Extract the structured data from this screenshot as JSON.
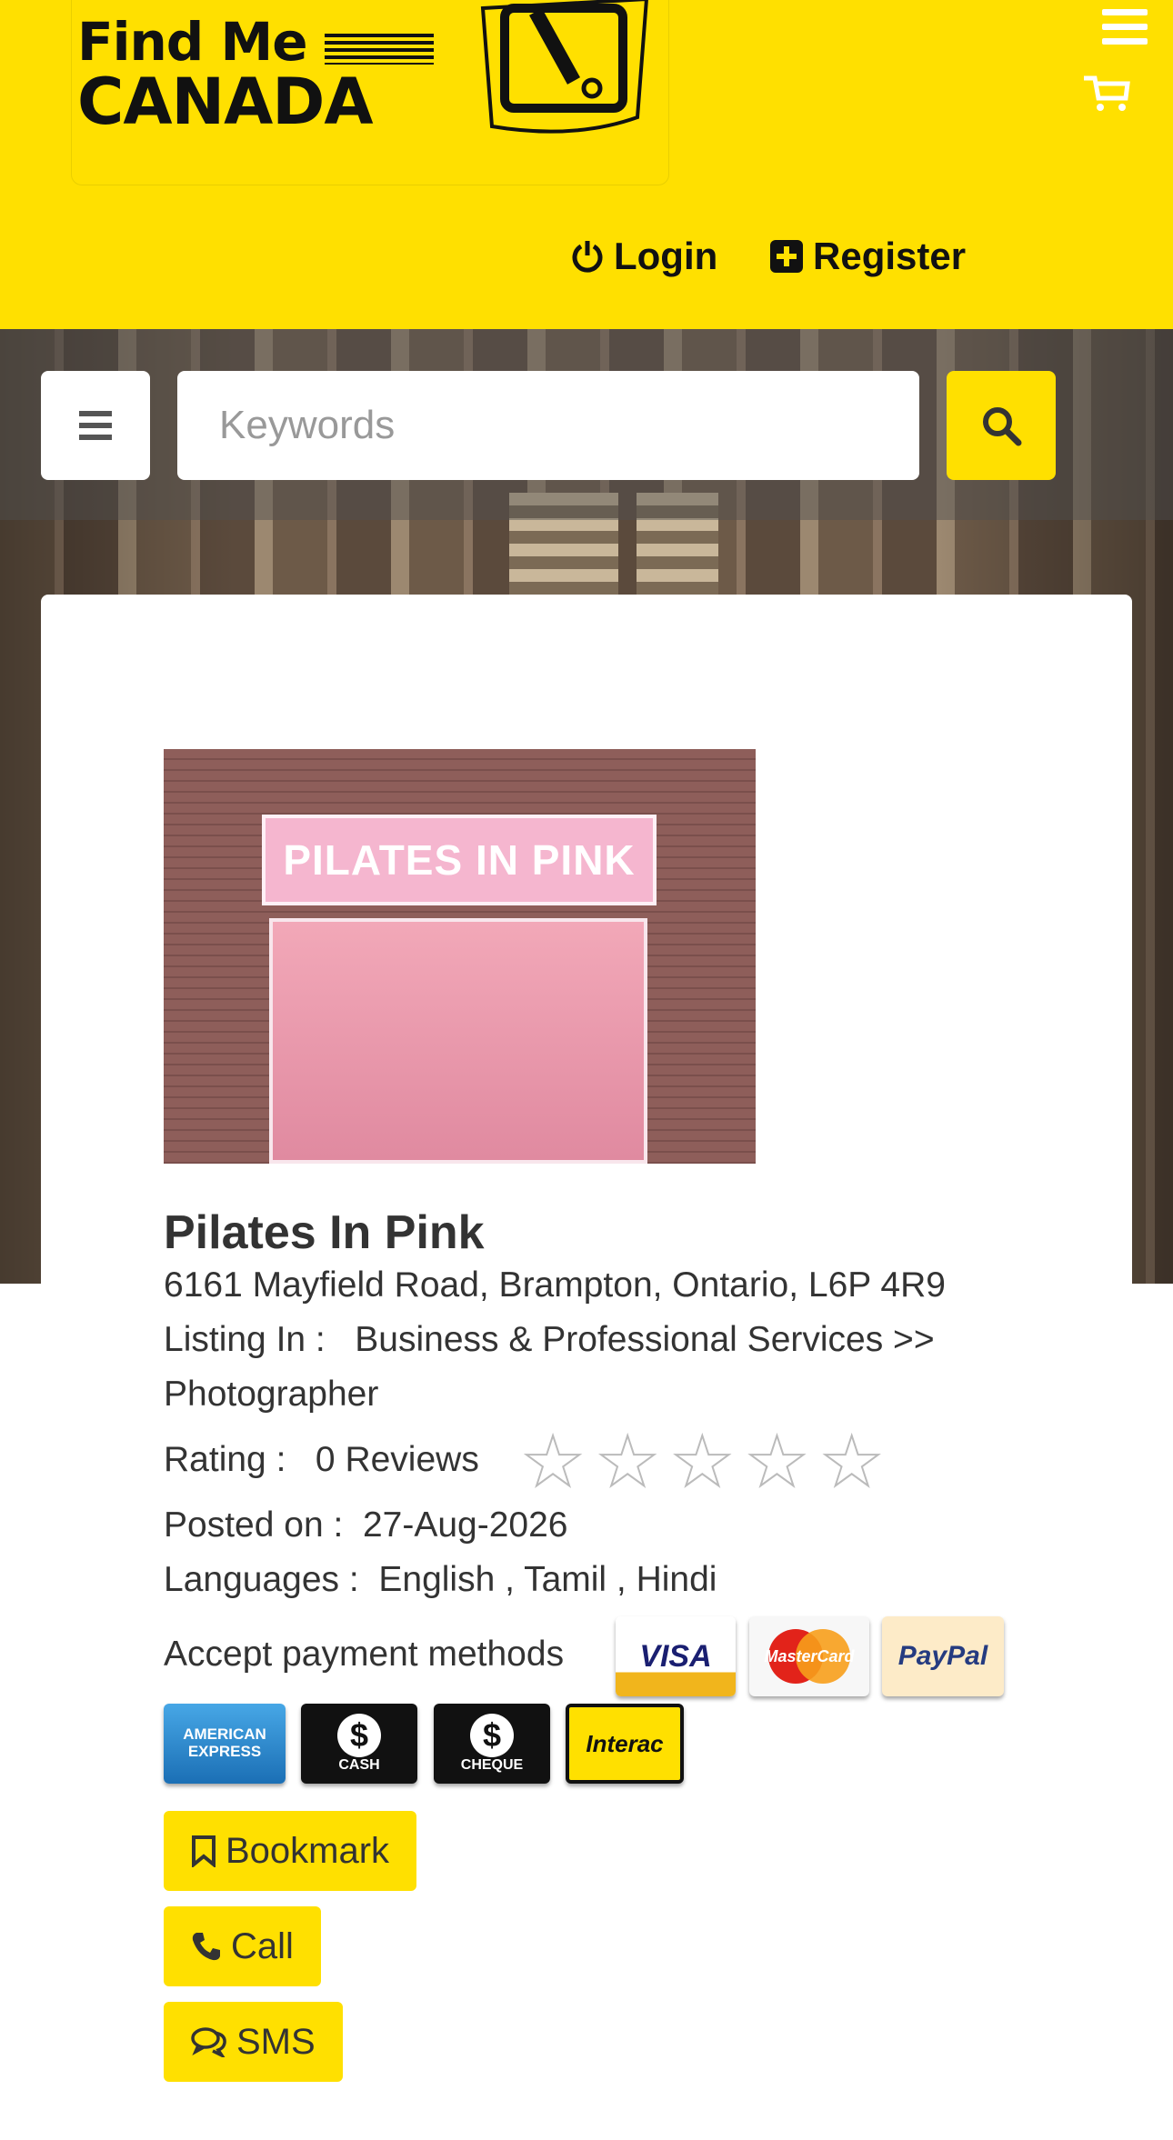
{
  "header": {
    "logo": {
      "line1": "Find Me",
      "line2": "CANADA"
    },
    "login_label": "Login",
    "register_label": "Register"
  },
  "search": {
    "placeholder": "Keywords"
  },
  "listing": {
    "photo_sign": "PILATES IN PINK",
    "name": "Pilates In Pink",
    "address": "6161 Mayfield Road, Brampton, Ontario, L6P 4R9",
    "listing_in_label": "Listing In :",
    "listing_in_value": "Business & Professional Services >>",
    "listing_in_value_2": "Photographer",
    "rating_label": "Rating :",
    "rating_reviews": "0 Reviews",
    "rating_stars": 0,
    "rating_max": 5,
    "posted_label": "Posted on :",
    "posted_value": "27-Aug-2026",
    "languages_label": "Languages :",
    "languages_value": "English , Tamil , Hindi",
    "payment_label": "Accept payment methods",
    "payment_methods": [
      "VISA",
      "MasterCard",
      "PayPal",
      "AMERICAN EXPRESS",
      "CASH",
      "CHEQUE",
      "Interac"
    ]
  },
  "actions": {
    "bookmark": "Bookmark",
    "call": "Call",
    "sms": "SMS"
  },
  "colors": {
    "brand_yellow": "#ffe000",
    "text": "#333333"
  },
  "icons": [
    "hamburger-icon",
    "cart-icon",
    "power-icon",
    "plus-square-icon",
    "bars-icon",
    "search-icon",
    "bookmark-icon",
    "phone-icon",
    "comments-icon"
  ]
}
